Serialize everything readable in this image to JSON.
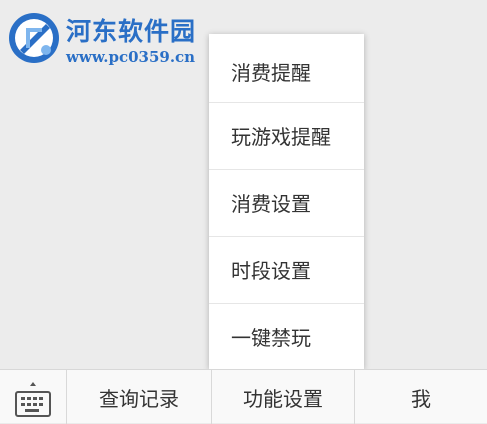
{
  "watermark": {
    "title": "河东软件园",
    "url": "www.pc0359.cn"
  },
  "popup_menu": {
    "items": [
      {
        "label": "消费提醒"
      },
      {
        "label": "玩游戏提醒"
      },
      {
        "label": "消费设置"
      },
      {
        "label": "时段设置"
      },
      {
        "label": "一键禁玩"
      }
    ]
  },
  "tabbar": {
    "keyboard_icon": "keyboard-icon",
    "tabs": [
      {
        "label": "查询记录"
      },
      {
        "label": "功能设置"
      },
      {
        "label": "我"
      }
    ]
  },
  "colors": {
    "background": "#ececec",
    "menu_background": "#ffffff",
    "text": "#333333",
    "watermark_blue": "#2a6fc6"
  }
}
